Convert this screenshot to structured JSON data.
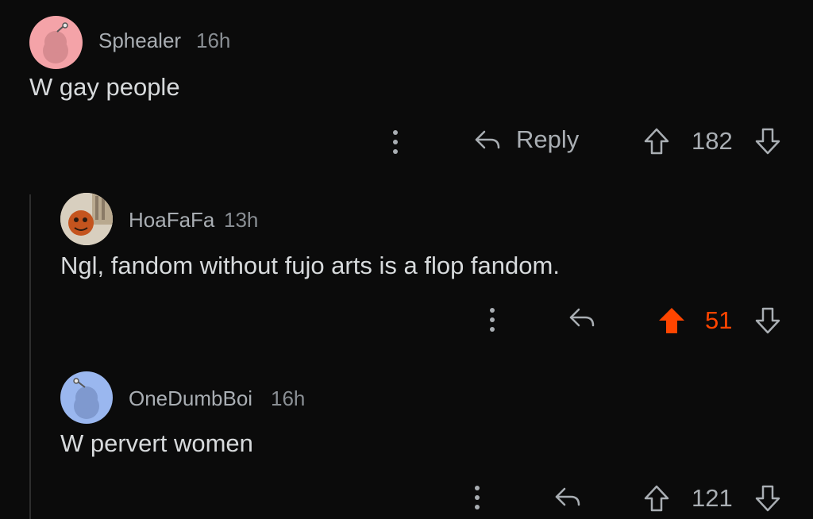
{
  "comments": [
    {
      "username": "Sphealer",
      "time": "16h",
      "body": "W gay people",
      "reply_label": "Reply",
      "score": "182",
      "avatar_color": "#f4a3a8"
    },
    {
      "username": "HoaFaFa",
      "time": "13h",
      "body": "Ngl, fandom without fujo arts is a flop fandom.",
      "score": "51",
      "upvoted": true,
      "upvote_color": "#ff4500"
    },
    {
      "username": "OneDumbBoi",
      "time": "16h",
      "body": "W pervert women",
      "score": "121",
      "avatar_color": "#9ab7ef"
    }
  ],
  "icons": {
    "more": "more-vertical-icon",
    "reply": "reply-arrow-icon",
    "upvote": "upvote-arrow-icon",
    "downvote": "downvote-arrow-icon"
  }
}
